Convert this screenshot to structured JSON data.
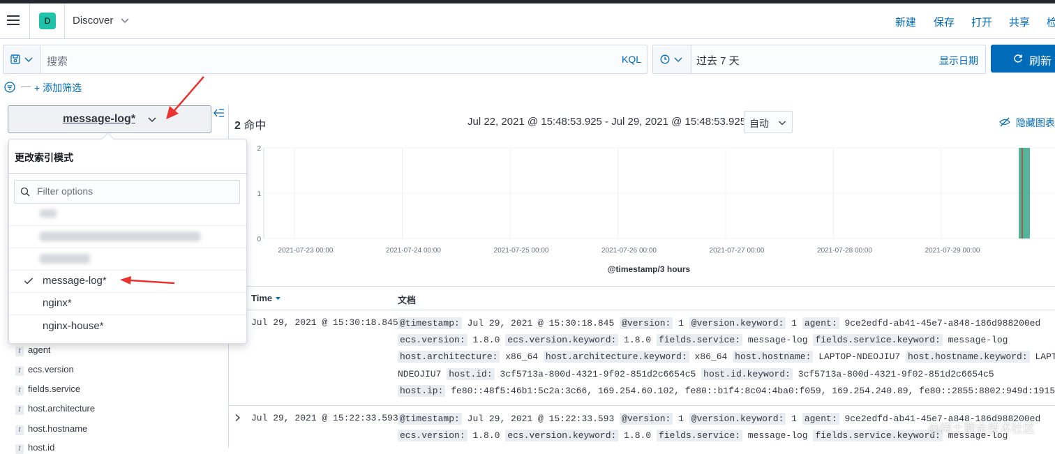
{
  "header": {
    "space_initial": "D",
    "app_title": "Discover",
    "nav": {
      "new": "新建",
      "save": "保存",
      "open": "打开",
      "share": "共享",
      "inspect": "检"
    }
  },
  "query": {
    "search_placeholder": "搜索",
    "kql": "KQL",
    "time_range": "过去 7 天",
    "show_dates": "显示日期",
    "refresh": "刷新"
  },
  "filters": {
    "add_filter": "+ 添加筛选"
  },
  "index_pattern": {
    "selected": "message-log*",
    "panel_title": "更改索引模式",
    "filter_placeholder": "Filter options",
    "options": [
      "message-log*",
      "nginx*",
      "nginx-house*"
    ]
  },
  "sidebar": {
    "fields": [
      "agent",
      "ecs.version",
      "fields.service",
      "host.architecture",
      "host.hostname",
      "host.id"
    ]
  },
  "chart_header": {
    "hits_count": "2",
    "hits_label": "命中",
    "range": "Jul 22, 2021 @ 15:48:53.925 - Jul 29, 2021 @ 15:48:53.925",
    "interval": "自动",
    "hide_chart": "隐藏图表"
  },
  "chart_data": {
    "type": "bar",
    "xlabel": "@timestamp/3 hours",
    "ylabel": "",
    "ylim": [
      0,
      2
    ],
    "y_ticks": [
      "0",
      "1",
      "2"
    ],
    "x_tick_labels": [
      "2021-07-23 00:00",
      "2021-07-24 00:00",
      "2021-07-25 00:00",
      "2021-07-26 00:00",
      "2021-07-27 00:00",
      "2021-07-28 00:00",
      "2021-07-29 00:00"
    ],
    "categories": [
      "2021-07-29 15:00"
    ],
    "values": [
      2
    ],
    "grid": true,
    "bar_color": "#54b399"
  },
  "table": {
    "col_time": "Time",
    "col_doc": "文档",
    "rows": [
      {
        "time": "Jul 29, 2021 @ 15:30:18.845",
        "lines": [
          [
            [
              "@timestamp:",
              "Jul 29, 2021 @ 15:30:18.845"
            ],
            [
              "@version:",
              "1"
            ],
            [
              "@version.keyword:",
              "1"
            ],
            [
              "agent:",
              "9ce2edfd-ab41-45e7-a848-186d988200ed"
            ]
          ],
          [
            [
              "ecs.version:",
              "1.8.0"
            ],
            [
              "ecs.version.keyword:",
              "1.8.0"
            ],
            [
              "fields.service:",
              "message-log"
            ],
            [
              "fields.service.keyword:",
              "message-log"
            ]
          ],
          [
            [
              "host.architecture:",
              "x86_64"
            ],
            [
              "host.architecture.keyword:",
              "x86_64"
            ],
            [
              "host.hostname:",
              "LAPTOP-NDEOJIU7"
            ],
            [
              "host.hostname.keyword:",
              "LAPTOP-"
            ]
          ],
          [
            [
              "",
              "NDEOJIU7"
            ],
            [
              "host.id:",
              "3cf5713a-800d-4321-9f02-851d2c6654c5"
            ],
            [
              "host.id.keyword:",
              "3cf5713a-800d-4321-9f02-851d2c6654c5"
            ]
          ],
          [
            [
              "host.ip:",
              "fe80::48f5:46b1:5c2a:3c66, 169.254.60.102, fe80::b1f4:8c04:4ba0:f059, 169.254.240.89, fe80::2855:8802:949d:1915,"
            ]
          ]
        ]
      },
      {
        "time": "Jul 29, 2021 @ 15:22:33.593",
        "lines": [
          [
            [
              "@timestamp:",
              "Jul 29, 2021 @ 15:22:33.593"
            ],
            [
              "@version:",
              "1"
            ],
            [
              "@version.keyword:",
              "1"
            ],
            [
              "agent:",
              "9ce2edfd-ab41-45e7-a848-186d988200ed"
            ]
          ],
          [
            [
              "ecs.version:",
              "1.8.0"
            ],
            [
              "ecs.version.keyword:",
              "1.8.0"
            ],
            [
              "fields.service:",
              "message-log"
            ],
            [
              "fields.service.keyword:",
              "message-log"
            ]
          ]
        ]
      }
    ]
  },
  "watermark": "@稀土掘金技术社区"
}
